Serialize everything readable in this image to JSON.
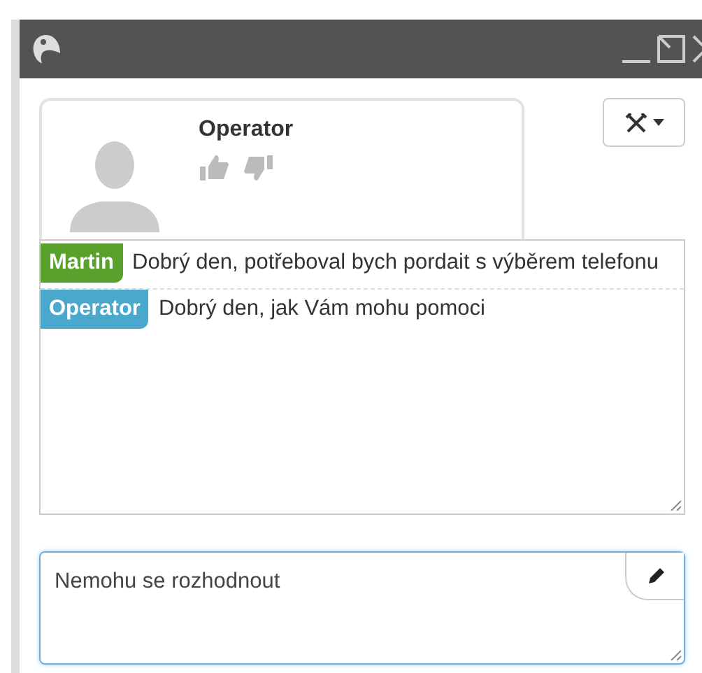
{
  "operator": {
    "name": "Operator"
  },
  "messages": [
    {
      "sender": "Martin",
      "color": "#5aa02c",
      "text": "Dobrý den, potřeboval bych pordait s výběrem telefonu"
    },
    {
      "sender": "Operator",
      "color": "#4aa8cc",
      "text": "Dobrý den, jak Vám mohu pomoci"
    }
  ],
  "reply": {
    "value": "Nemohu se rozhodnout"
  }
}
